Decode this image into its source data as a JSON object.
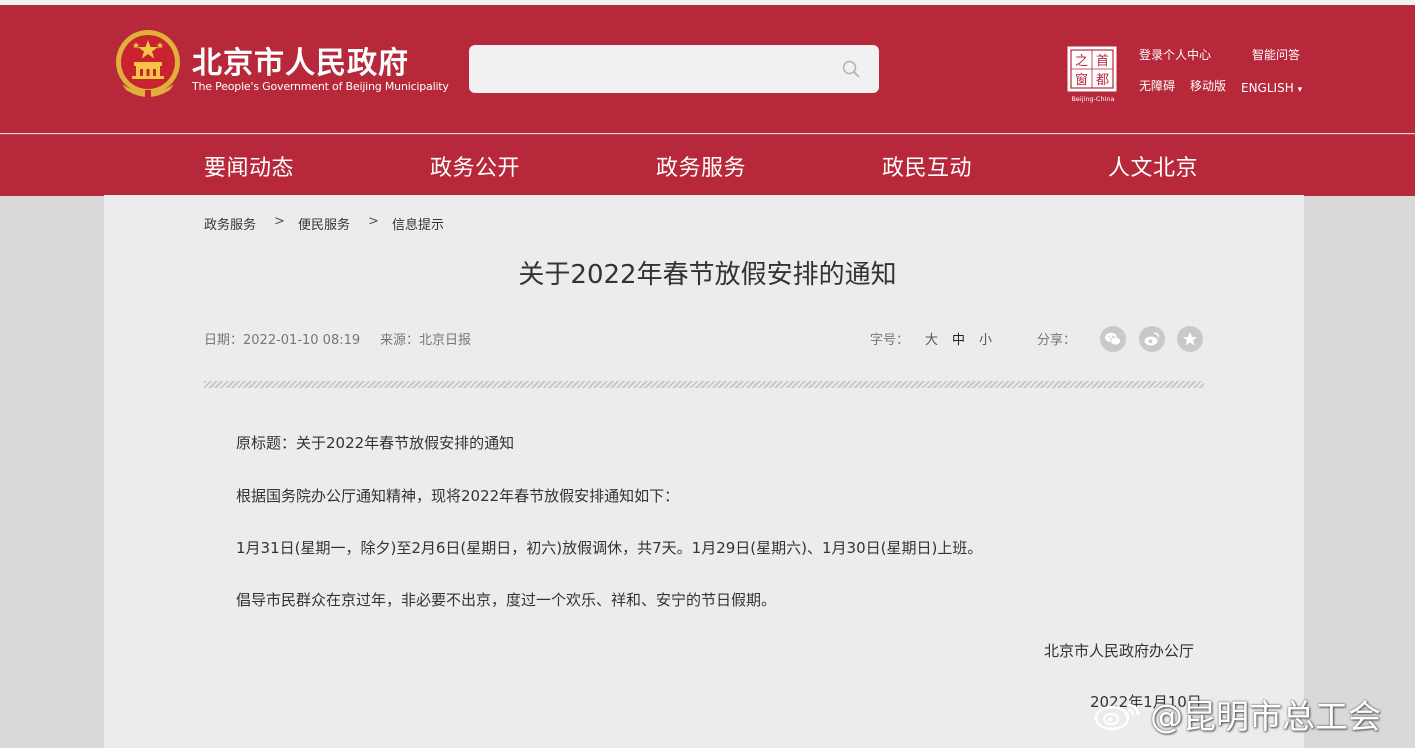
{
  "header": {
    "site_title": "北京市人民政府",
    "site_subtitle": "The People's Government of Beijing Municipality",
    "search_placeholder": "",
    "capital_logo_chars": [
      "之",
      "首",
      "窗",
      "都"
    ],
    "capital_logo_caption": "Beijing-China",
    "links": {
      "login": "登录个人中心",
      "qa": "智能问答",
      "accessibility": "无障碍",
      "mobile": "移动版",
      "english": "ENGLISH",
      "english_arrow": "▾"
    }
  },
  "nav": [
    "要闻动态",
    "政务公开",
    "政务服务",
    "政民互动",
    "人文北京"
  ],
  "breadcrumb": {
    "items": [
      "政务服务",
      "便民服务",
      "信息提示"
    ],
    "separator": ">"
  },
  "article": {
    "title": "关于2022年春节放假安排的通知",
    "date": "日期：2022-01-10 08:19",
    "source": "来源：北京日报",
    "font_size_label": "字号：",
    "font_sizes": [
      "大",
      "中",
      "小"
    ],
    "share_label": "分享：",
    "share_icons": [
      "wechat-icon",
      "weibo-icon",
      "favorite-icon"
    ],
    "paragraphs": [
      "原标题：关于2022年春节放假安排的通知",
      "根据国务院办公厅通知精神，现将2022年春节放假安排通知如下：",
      "1月31日(星期一，除夕)至2月6日(星期日，初六)放假调休，共7天。1月29日(星期六)、1月30日(星期日)上班。",
      "倡导市民群众在京过年，非必要不出京，度过一个欢乐、祥和、安宁的节日假期。"
    ],
    "signature": "北京市人民政府办公厅",
    "sign_date": "2022年1月10日"
  },
  "watermark": {
    "text": "@昆明市总工会"
  },
  "colors": {
    "brand_red": "#b6283a",
    "content_bg": "#ececec",
    "page_bg": "#d9d9d9"
  }
}
